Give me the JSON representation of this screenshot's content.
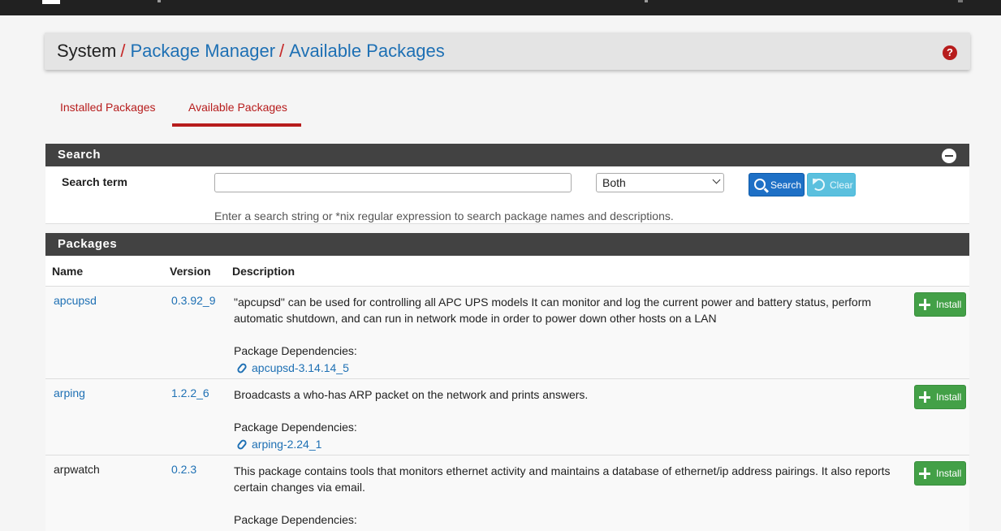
{
  "breadcrumb": {
    "root": "System",
    "separator": "/",
    "section": "Package Manager",
    "page": "Available Packages",
    "help": "?"
  },
  "tabs": [
    {
      "label": "Installed Packages",
      "active": false
    },
    {
      "label": "Available Packages",
      "active": true
    }
  ],
  "search": {
    "panel_title": "Search",
    "term_label": "Search term",
    "term_value": "",
    "scope_value": "Both",
    "search_button": "Search",
    "clear_button": "Clear",
    "help_text": "Enter a search string or *nix regular expression to search package names and descriptions."
  },
  "packages": {
    "panel_title": "Packages",
    "columns": [
      "Name",
      "Version",
      "Description"
    ],
    "install_label": "Install",
    "dependencies_label": "Package Dependencies:",
    "rows": [
      {
        "name": "apcupsd",
        "version": "0.3.92_9",
        "description": "\"apcupsd\" can be used for controlling all APC UPS models It can monitor and log the current power and battery status, perform automatic shutdown, and can run in network mode in order to power down other hosts on a LAN",
        "dependency": "apcupsd-3.14.14_5"
      },
      {
        "name": "arping",
        "version": "1.2.2_6",
        "description": "Broadcasts a who-has ARP packet on the network and prints answers.",
        "dependency": "arping-2.24_1"
      },
      {
        "name": "arpwatch",
        "version": "0.2.3",
        "description": "This package contains tools that monitors ethernet activity and maintains a database of ethernet/ip address pairings. It also reports certain changes via email.",
        "dependency": ""
      }
    ]
  },
  "colors": {
    "accent_red": "#b71c1c",
    "link_blue": "#1e70b4",
    "panel_header": "#424242",
    "install_green": "#43a047"
  }
}
